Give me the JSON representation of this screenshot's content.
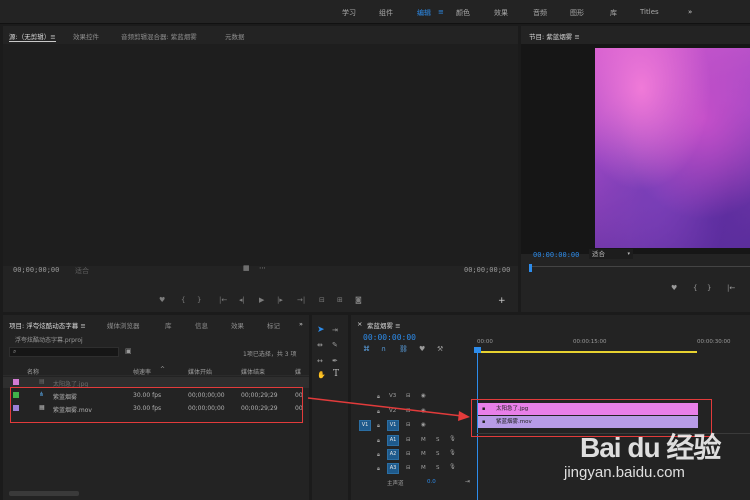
{
  "workspaces": [
    "学习",
    "组件",
    "编辑",
    "颜色",
    "效果",
    "音频",
    "图形",
    "库",
    "Titles"
  ],
  "workspace_menu_icon": "hamburger-icon",
  "more_workspaces_label": "»",
  "source_panel": {
    "tabs": [
      "源:（无剪辑）≡",
      "效果控件",
      "音频剪辑混合器: 紫蓝烟雾",
      "元数据"
    ],
    "timecode_left": "00;00;00;00",
    "timecode_right": "00;00;00;00",
    "timecode_right2": "00;00;00;00",
    "fit_label": "适合"
  },
  "program_panel": {
    "title": "节目: 紫蓝烟雾 ≡",
    "timecode": "00:00:00:00",
    "fit_label": "适合"
  },
  "project_panel": {
    "tabs": [
      "项目: 浮夸炫酷动态字幕 ≡",
      "媒体浏览器",
      "库",
      "信息",
      "效果",
      "标记"
    ],
    "overflow": "»",
    "project_file": "浮夸炫酷动态字幕.prproj",
    "selection_info": "1项已选择，共 3 项",
    "columns": [
      "名称",
      "帧速率",
      "媒体开始",
      "媒体结束",
      "媒"
    ],
    "items": [
      {
        "name": "太阳急了.jpg",
        "fps": "",
        "start": "",
        "end": "",
        "extra": "",
        "color": "#d37bd3",
        "dim": true
      },
      {
        "name": "紫蓝烟雾",
        "fps": "30.00 fps",
        "start": "00;00;00;00",
        "end": "00;00;29;29",
        "extra": "00",
        "color": "#3fb24a",
        "dim": false
      },
      {
        "name": "紫蓝烟雾.mov",
        "fps": "30.00 fps",
        "start": "00;00;00;00",
        "end": "00;00;29;29",
        "extra": "00",
        "color": "#9a7fd6",
        "dim": false
      }
    ]
  },
  "tools_panel": {
    "tools": [
      "selection-tool",
      "track-select-tool",
      "ripple-edit-tool",
      "razor-tool",
      "slip-tool",
      "pen-tool",
      "hand-tool",
      "type-tool"
    ]
  },
  "timeline_panel": {
    "tab": "紫蓝烟雾 ≡",
    "timecode": "00:00:00:00",
    "ruler": [
      "00:00",
      "00:00:15:00",
      "00:00:30:00"
    ],
    "video_tracks": [
      "V3",
      "V2",
      "V1"
    ],
    "audio_tracks": [
      "A1",
      "A2",
      "A3"
    ],
    "source_patch_v": "V1",
    "track_mute": "M",
    "track_solo": "S",
    "master_label": "主声道",
    "master_value": "0.0",
    "clips": [
      {
        "label": "太阳急了.jpg",
        "track": "V2",
        "color": "#e87fe8"
      },
      {
        "label": "紫蓝烟雾.mov",
        "track": "V1",
        "color": "#b79be6"
      }
    ]
  },
  "watermark": {
    "brand": "Bai du 经验",
    "url": "jingyan.baidu.com"
  }
}
